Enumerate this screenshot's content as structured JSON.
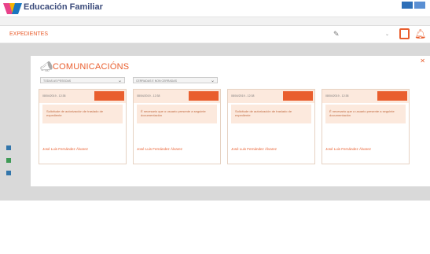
{
  "app": {
    "title": "Educación Familiar"
  },
  "header": {
    "section": "EXPEDIENTES"
  },
  "modal": {
    "title": "COMUNICACIÓNS",
    "filter1": "TODAS AS PESSOAS",
    "filter2": "CERRADAS E NON CERRADAS",
    "cards": [
      {
        "date": "08/04/2019 - 12:38",
        "description": "Solicitude de autorización de traslado de expediente",
        "assignee": "José Luis Fernández Álvarez"
      },
      {
        "date": "08/04/2019 - 12:38",
        "description": "É necesario que o usuario presente a seguinte documentación",
        "assignee": "José Luis Fernández Álvarez"
      },
      {
        "date": "08/04/2019 - 12:38",
        "description": "Solicitude de autorización de traslado de expediente",
        "assignee": "José Luis Fernández Álvarez"
      },
      {
        "date": "08/04/2019 - 12:38",
        "description": "É necesario que o usuario presente a seguinte documentación",
        "assignee": "José Luis Fernández Álvarez"
      }
    ]
  },
  "colors": {
    "accent": "#e95e2e",
    "brand": "#3a4a7a"
  },
  "icons": {
    "logo": "logo-ribbon-icon",
    "edit": "pencil-icon",
    "doc": "document-icon",
    "bell": "bell-icon",
    "close": "close-icon",
    "megaphone": "megaphone-icon"
  }
}
